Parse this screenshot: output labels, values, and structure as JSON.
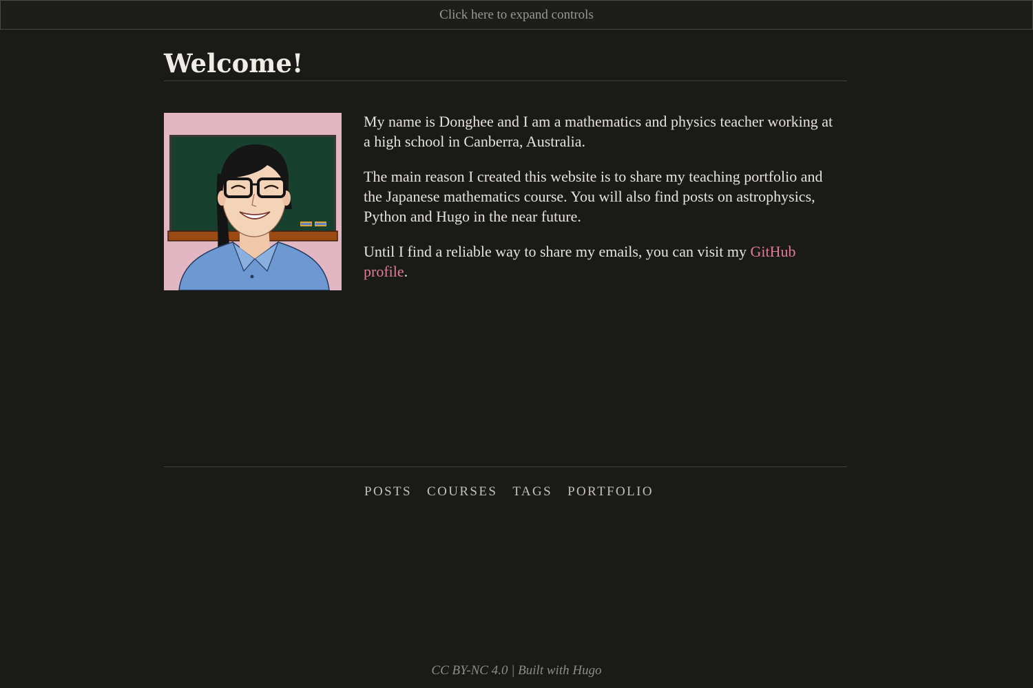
{
  "controls": {
    "toggle_label": "Click here to expand controls"
  },
  "page": {
    "title": "Welcome!"
  },
  "avatar": {
    "alt": "Cartoon portrait of Donghee in front of a chalkboard"
  },
  "bio": {
    "p1": "My name is Donghee and I am a mathematics and physics teacher working at a high school in Canberra, Australia.",
    "p2": "The main reason I created this website is to share my teaching portfolio and the Japanese mathematics course. You will also find posts on astrophysics, Python and Hugo in the near future.",
    "p3_before": "Until I find a reliable way to share my emails, you can visit my ",
    "p3_link": "GitHub profile",
    "p3_after": "."
  },
  "nav": {
    "items": [
      {
        "label": "POSTS"
      },
      {
        "label": "COURSES"
      },
      {
        "label": "TAGS"
      },
      {
        "label": "PORTFOLIO"
      }
    ]
  },
  "footer": {
    "copyright": "CC BY-NC 4.0 | Built with Hugo"
  },
  "colors": {
    "background": "#1a1a19",
    "text": "#e6e3dc",
    "link": "#e27b95",
    "avatar_background": "#e2b6c2",
    "chalkboard": "#18402f",
    "shirt": "#6e98d2"
  }
}
